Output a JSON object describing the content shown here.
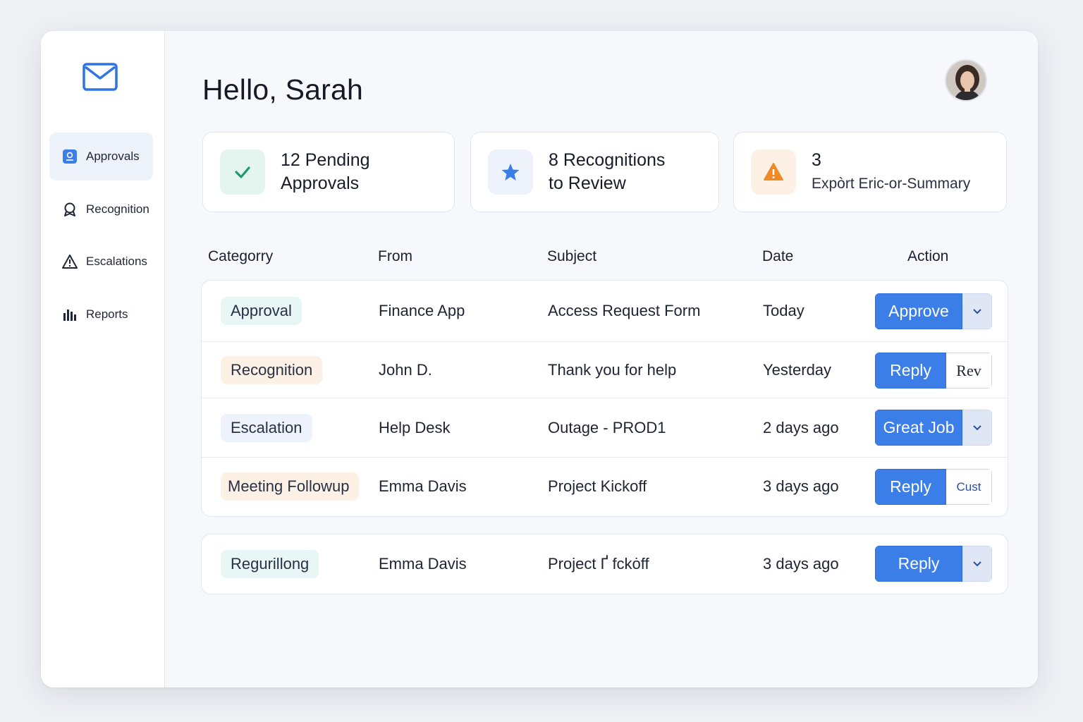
{
  "sidebar": {
    "items": [
      {
        "label": "Approvals",
        "icon": "approvals-icon",
        "active": true
      },
      {
        "label": "Recognition",
        "icon": "recognition-icon",
        "active": false
      },
      {
        "label": "Escalations",
        "icon": "warning-icon",
        "active": false
      },
      {
        "label": "Reports",
        "icon": "bar-chart-icon",
        "active": false
      }
    ]
  },
  "header": {
    "greeting": "Hello, Sarah"
  },
  "cards": [
    {
      "line1": "12 Pending",
      "line2": "Approvals",
      "icon": "check-icon",
      "color": "#1f9a6a"
    },
    {
      "line1": "8 Recognitions",
      "line2": "to Review",
      "icon": "star-icon",
      "color": "#3b7ee8"
    },
    {
      "line1": "3",
      "line2": "Expòrt Eric-or-Summary",
      "icon": "warning-icon",
      "color": "#f08a24"
    }
  ],
  "table": {
    "headers": {
      "category": "Categorry",
      "from": "From",
      "subject": "Subject",
      "date": "Date",
      "action": "Action"
    },
    "rows": [
      {
        "category": "Approval",
        "from": "Finance App",
        "subject": "Access Request Form",
        "date": "Today",
        "primary": "Approve",
        "secondary": ""
      },
      {
        "category": "Recognition",
        "from": "John D.",
        "subject": "Thank you for help",
        "date": "Yesterday",
        "primary": "Reply",
        "secondary": "Rev"
      },
      {
        "category": "Escalation",
        "from": "Help Desk",
        "subject": "Outage - PROD1",
        "date": "2 days ago",
        "primary": "Great Job",
        "secondary": ""
      },
      {
        "category": "Meeting Followup",
        "from": "Emma Davis",
        "subject": "Project Kickoff",
        "date": "3 days ago",
        "primary": "Reply",
        "secondary": "Cust"
      }
    ],
    "extra_row": {
      "category": "Regurillong",
      "from": "Emma Davis",
      "subject": "Project Ґ fckȯff",
      "date": "3 days ago",
      "primary": "Reply",
      "secondary": ""
    }
  },
  "colors": {
    "accent": "#3b7ee8",
    "success": "#1f9a6a",
    "warning": "#f08a24"
  }
}
